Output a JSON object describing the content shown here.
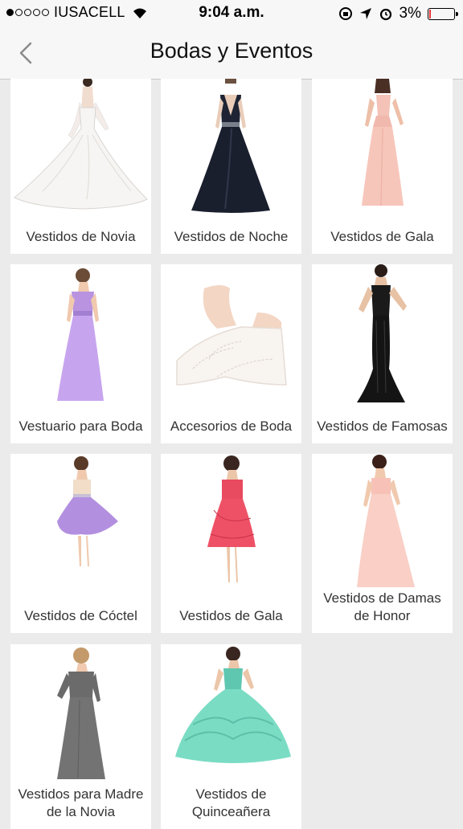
{
  "status_bar": {
    "signal_dots_filled": 1,
    "signal_dots_total": 5,
    "carrier": "IUSACELL",
    "time": "9:04 a.m.",
    "battery_percent": "3%",
    "icons": [
      "wifi-icon",
      "rotation-lock-icon",
      "location-arrow-icon",
      "alarm-icon",
      "battery-icon"
    ]
  },
  "nav": {
    "back_icon": "chevron-left-icon",
    "title": "Bodas y Eventos"
  },
  "categories": [
    {
      "label": "Vestidos de Novia",
      "image": "white-lace-wedding-dress"
    },
    {
      "label": "Vestidos de Noche",
      "image": "navy-evening-gown"
    },
    {
      "label": "Vestidos de Gala",
      "image": "blush-pink-gown"
    },
    {
      "label": "Vestuario para Boda",
      "image": "lavender-strapless-gown"
    },
    {
      "label": "Accesorios de Boda",
      "image": "lace-bridal-gloves"
    },
    {
      "label": "Vestidos de Famosas",
      "image": "black-sequin-mermaid-gown"
    },
    {
      "label": "Vestidos de Cóctel",
      "image": "lilac-cocktail-dress"
    },
    {
      "label": "Vestidos de Gala",
      "image": "red-lace-short-dress"
    },
    {
      "label": "Vestidos de Damas de Honor",
      "image": "pink-bridesmaid-gown"
    },
    {
      "label": "Vestidos para Madre de la Novia",
      "image": "grey-lace-mother-gown"
    },
    {
      "label": "Vestidos de Quinceañera",
      "image": "mint-ruffled-ball-gown"
    }
  ]
}
